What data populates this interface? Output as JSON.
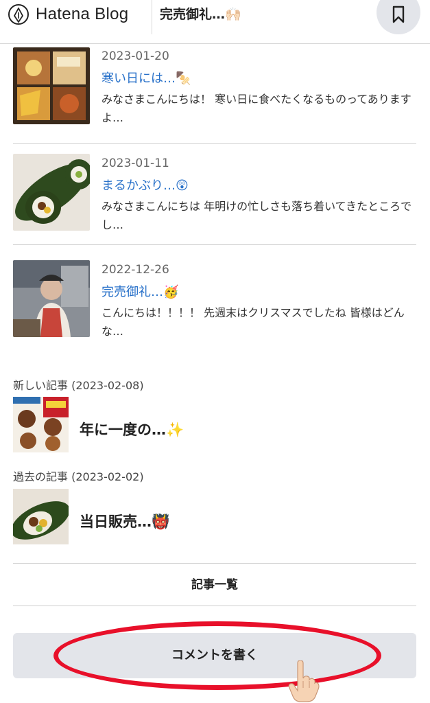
{
  "header": {
    "logo_text": "Hatena Blog",
    "title": "完売御礼…🙌🏻",
    "bookmark_icon": "bookmark-icon"
  },
  "articles": [
    {
      "date": "2023-01-20",
      "title": "寒い日には…🍢",
      "excerpt": "みなさまこんにちは！ 寒い日に食べたくなるものってありますよ…",
      "thumb": "osechi-box-photo"
    },
    {
      "date": "2023-01-11",
      "title": "まるかぶり…😲",
      "excerpt": "みなさまこんにちは 年明けの忙しさも落ち着いてきたところでし…",
      "thumb": "ehomaki-roll-photo"
    },
    {
      "date": "2022-12-26",
      "title": "完売御礼…🥳",
      "excerpt": "こんにちは！！！！ 先週末はクリスマスでしたね 皆様はどんな…",
      "thumb": "shop-staff-photo"
    }
  ],
  "newer": {
    "label": "新しい記事 (2023-02-08)",
    "title": "年に一度の…✨",
    "thumb": "meat-day-flyer"
  },
  "older": {
    "label": "過去の記事 (2023-02-02)",
    "title": "当日販売…👹",
    "thumb": "ehomaki-cut-photo"
  },
  "archive_label": "記事一覧",
  "comment_label": "コメントを書く",
  "colors": {
    "link": "#2770c9",
    "button_bg": "#e3e5ea",
    "annotation": "#e8102a"
  }
}
